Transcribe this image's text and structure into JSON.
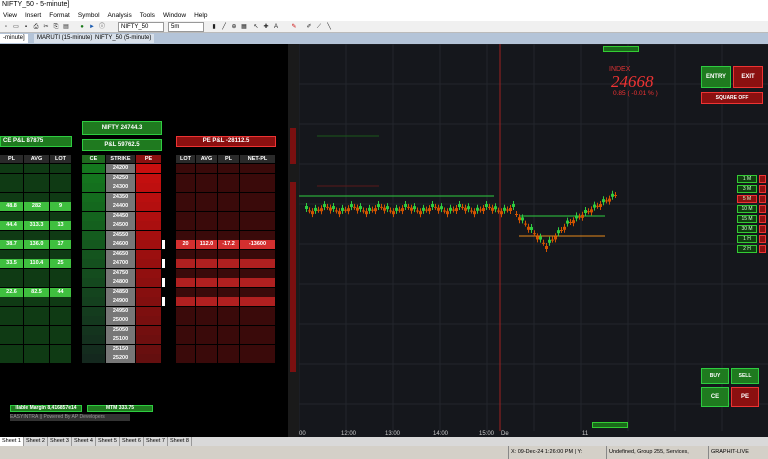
{
  "window": {
    "title": "NIFTY_50 - 5-minute]"
  },
  "menu": [
    "View",
    "Insert",
    "Format",
    "Symbol",
    "Analysis",
    "Tools",
    "Window",
    "Help"
  ],
  "toolbar": {
    "symbol": "NIFTY_50",
    "interval": "5m"
  },
  "tabs": [
    "-minute]",
    "MARUTI (15-minute)",
    "NIFTY_50 (5-minute)"
  ],
  "left": {
    "ce_pnl": "CE P&L 87875",
    "nifty": "NIFTY 24744.3",
    "pnl": "P&L 59762.5",
    "pe_pnl": "PE P&L -28112.5",
    "ce_cols": [
      "PL",
      "AVG",
      "LOT"
    ],
    "chain_cols": [
      "CE",
      "STRIKE",
      "PE"
    ],
    "pe_cols": [
      "LOT",
      "AVG",
      "PL",
      "NET-PL"
    ],
    "strikes": [
      "24200",
      "24250",
      "24300",
      "24350",
      "24400",
      "24450",
      "24500",
      "24550",
      "24600",
      "24650",
      "24700",
      "24750",
      "24800",
      "24850",
      "24900",
      "24950",
      "25000",
      "25050",
      "25100",
      "25150",
      "25200"
    ],
    "ce_rows": [
      {
        "row": 4,
        "pl": "48.8",
        "avg": "282",
        "lot": "9"
      },
      {
        "row": 6,
        "pl": "44.4",
        "avg": "313.3",
        "lot": "13"
      },
      {
        "row": 8,
        "pl": "38.7",
        "avg": "136.0",
        "lot": "17"
      },
      {
        "row": 10,
        "pl": "33.5",
        "avg": "110.4",
        "lot": "25"
      },
      {
        "row": 13,
        "pl": "22.6",
        "avg": "82.5",
        "lot": "44"
      }
    ],
    "pe_rows": [
      {
        "row": 8,
        "lot": "20",
        "avg": "112.0",
        "pl": "-17.2",
        "net": "-13600"
      }
    ],
    "margin": "ilable Margin 8,416857e14",
    "mtm": "MTM 333.75",
    "powered": "EASYINTRA || Powered By AP Developers"
  },
  "chart": {
    "index_label": "INDEX",
    "index_value": "24668",
    "index_change": "0.85  ( -0.01 % )",
    "buttons": {
      "entry": "ENTRY",
      "exit": "EXIT",
      "sqoff": "SQUARE OFF",
      "ce": "CE",
      "pe": "PE",
      "buy": "BUY",
      "sell": "SELL"
    },
    "timeframes": [
      "1 M",
      "3 M",
      "5 M",
      "10 M",
      "15 M",
      "30 M",
      "1 H",
      "2 H"
    ],
    "xticks": [
      "00",
      "12:00",
      "13:00",
      "14:00",
      "15:00",
      "De",
      "11"
    ]
  },
  "sheets": [
    "Sheet 1",
    "Sheet 2",
    "Sheet 3",
    "Sheet 4",
    "Sheet 5",
    "Sheet 6",
    "Sheet 7",
    "Sheet 8"
  ],
  "status": {
    "coords": "X: 09-Dec-24 1:26:00 PM | Y: 24544.870",
    "info": "Undefined, Group 255, Services, Advertising",
    "mode": "GRAPHIT-LIVE"
  },
  "colors": {
    "green": "#2ecc40",
    "red": "#d32f2f",
    "bg": "#15171c"
  }
}
